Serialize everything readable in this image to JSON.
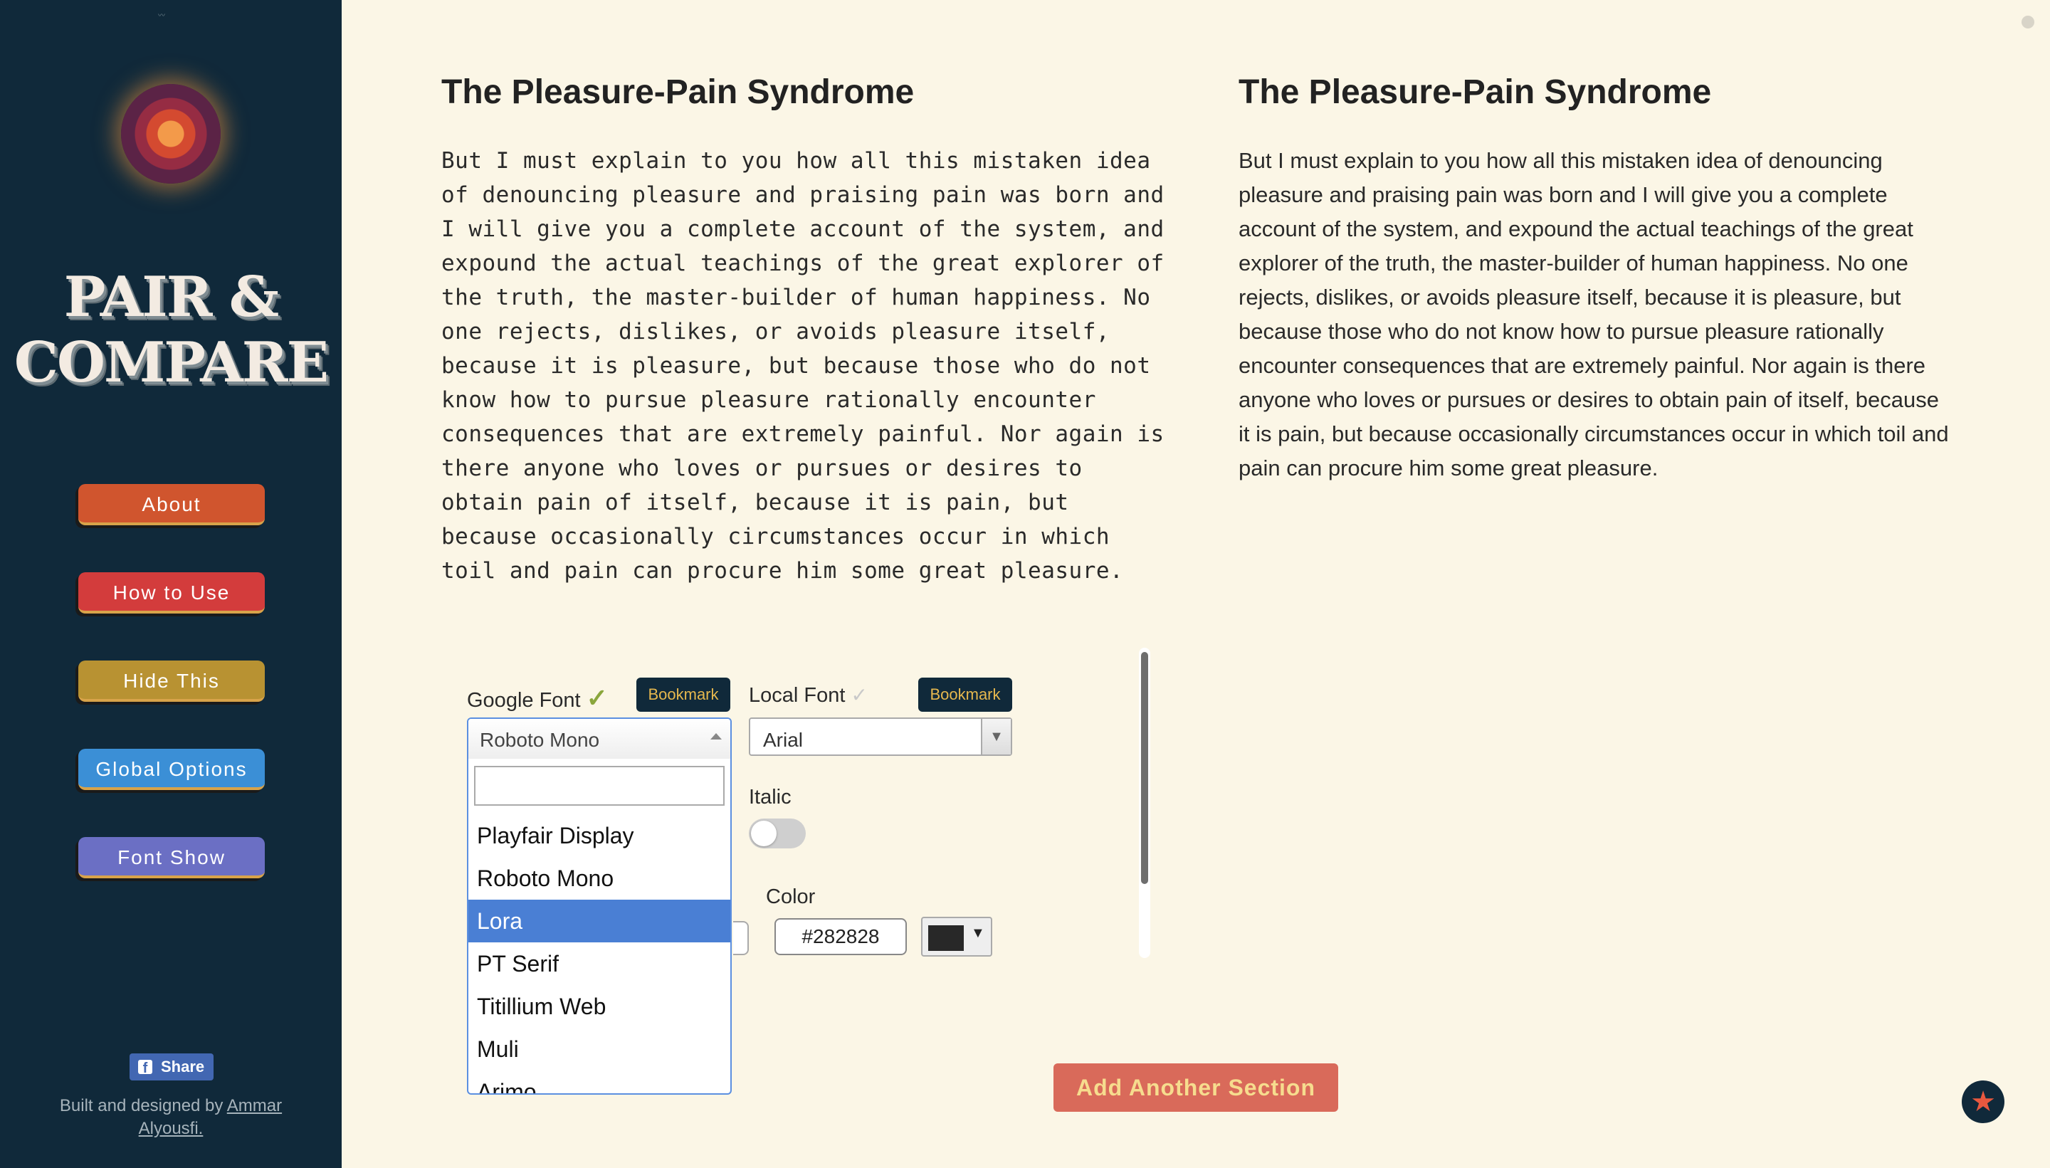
{
  "sidebar": {
    "brand_line1": "PAIR &",
    "brand_line2": "COMPARE",
    "nav": [
      {
        "label": "About",
        "color": "#d0552e"
      },
      {
        "label": "How to Use",
        "color": "#d33c3c"
      },
      {
        "label": "Hide This",
        "color": "#b89232"
      },
      {
        "label": "Global Options",
        "color": "#3b8fd6"
      },
      {
        "label": "Font Show",
        "color": "#6b6fc4"
      }
    ],
    "share_label": "Share",
    "share_icon": "f",
    "credits_text": "Built and designed by ",
    "credits_author": "Ammar Alyousfi."
  },
  "left": {
    "title": "The Pleasure-Pain Syndrome",
    "body": "But I must explain to you how all this mistaken idea of denouncing pleasure and praising pain was born and I will give you a complete account of the system, and expound the actual teachings of the great explorer of the truth, the master-builder of human happiness. No one rejects, dislikes, or avoids pleasure itself, because it is pleasure, but because those who do not know how to pursue pleasure rationally encounter consequences that are extremely painful. Nor again is there anyone who loves or pursues or desires to obtain pain of itself, because it is pain, but because occasionally circumstances occur in which toil and pain can procure him some great pleasure."
  },
  "right": {
    "title": "The Pleasure-Pain Syndrome",
    "body": "But I must explain to you how all this mistaken idea of denouncing pleasure and praising pain was born and I will give you a complete account of the system, and expound the actual teachings of the great explorer of the truth, the master-builder of human happiness. No one rejects, dislikes, or avoids pleasure itself, because it is pleasure, but because those who do not know how to pursue pleasure rationally encounter consequences that are extremely painful. Nor again is there anyone who loves or pursues or desires to obtain pain of itself, because it is pain, but because occasionally circumstances occur in which toil and pain can procure him some great pleasure."
  },
  "options": {
    "google_font_label": "Google Font",
    "google_check": "✓",
    "local_font_label": "Local Font",
    "local_check": "✓",
    "bookmark_label": "Bookmark",
    "google_selected": "Roboto Mono",
    "google_search_value": "",
    "google_options": [
      "Playfair Display",
      "Roboto Mono",
      "Lora",
      "PT Serif",
      "Titillium Web",
      "Muli",
      "Arimo"
    ],
    "google_highlighted": "Lora",
    "local_selected": "Arial",
    "italic_label": "Italic",
    "italic_on": false,
    "color_label": "Color",
    "color_value": "#282828"
  },
  "add_section_label": "Add Another Section",
  "fav_icon": "★"
}
